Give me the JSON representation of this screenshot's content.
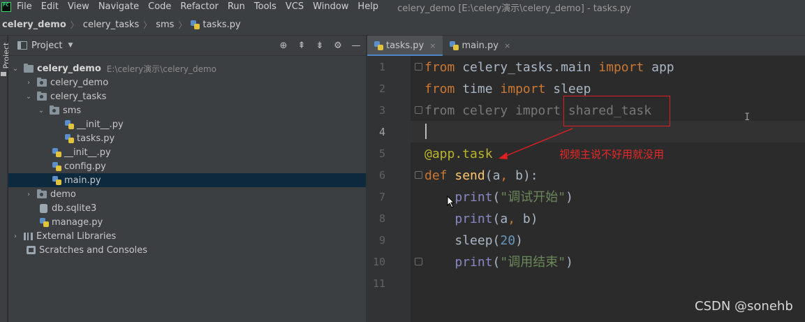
{
  "menubar": {
    "items": [
      "File",
      "Edit",
      "View",
      "Navigate",
      "Code",
      "Refactor",
      "Run",
      "Tools",
      "VCS",
      "Window",
      "Help"
    ],
    "window_title": "celery_demo [E:\\celery演示\\celery_demo] - tasks.py"
  },
  "breadcrumb": [
    "celery_demo",
    "celery_tasks",
    "sms",
    "tasks.py"
  ],
  "left_strip": {
    "label": "Project"
  },
  "project_panel": {
    "title": "Project",
    "tree": [
      {
        "label": "celery_demo",
        "path": "E:\\celery演示\\celery_demo",
        "type": "folder",
        "expanded": true,
        "bold": true
      },
      {
        "label": "celery_demo",
        "type": "package",
        "expanded": false
      },
      {
        "label": "celery_tasks",
        "type": "package",
        "expanded": true
      },
      {
        "label": "sms",
        "type": "package",
        "expanded": true
      },
      {
        "label": "__init__.py",
        "type": "python"
      },
      {
        "label": "tasks.py",
        "type": "python"
      },
      {
        "label": "__init__.py",
        "type": "python"
      },
      {
        "label": "config.py",
        "type": "python"
      },
      {
        "label": "main.py",
        "type": "python",
        "selected": true
      },
      {
        "label": "demo",
        "type": "package",
        "expanded": false
      },
      {
        "label": "db.sqlite3",
        "type": "database"
      },
      {
        "label": "manage.py",
        "type": "python"
      },
      {
        "label": "External Libraries",
        "type": "libraries",
        "expanded": false
      },
      {
        "label": "Scratches and Consoles",
        "type": "scratches"
      }
    ]
  },
  "editor_tabs": [
    {
      "label": "tasks.py",
      "active": true,
      "close": "×"
    },
    {
      "label": "main.py",
      "active": false,
      "close": "×"
    }
  ],
  "editor": {
    "current_line": 4,
    "line_numbers": [
      "1",
      "2",
      "3",
      "4",
      "5",
      "6",
      "7",
      "8",
      "9",
      "10",
      "11"
    ],
    "lines": [
      [
        [
          "kw",
          "from"
        ],
        [
          "id",
          " celery_tasks.main "
        ],
        [
          "kw",
          "import"
        ],
        [
          "id",
          " app"
        ]
      ],
      [
        [
          "kw",
          "from"
        ],
        [
          "id",
          " time "
        ],
        [
          "kw",
          "import"
        ],
        [
          "id",
          " sleep"
        ]
      ],
      [
        [
          "dim",
          "from celery import shared_task"
        ]
      ],
      [],
      [
        [
          "deco",
          "@app.task"
        ]
      ],
      [
        [
          "kw",
          "def"
        ],
        [
          "id",
          " "
        ],
        [
          "fn",
          "send"
        ],
        [
          "id",
          "("
        ],
        [
          "param",
          "a"
        ],
        [
          "kw",
          ","
        ],
        [
          "param",
          " b"
        ],
        [
          "id",
          "):"
        ]
      ],
      [
        [
          "id",
          "    "
        ],
        [
          "builtin",
          "print"
        ],
        [
          "id",
          "("
        ],
        [
          "str",
          "\"调试开始\""
        ],
        [
          "id",
          ")"
        ]
      ],
      [
        [
          "id",
          "    "
        ],
        [
          "builtin",
          "print"
        ],
        [
          "id",
          "(a"
        ],
        [
          "kw",
          ","
        ],
        [
          "id",
          " b)"
        ]
      ],
      [
        [
          "id",
          "    "
        ],
        [
          "id",
          "sleep("
        ],
        [
          "num",
          "20"
        ],
        [
          "id",
          ")"
        ]
      ],
      [
        [
          "id",
          "    "
        ],
        [
          "builtin",
          "print"
        ],
        [
          "id",
          "("
        ],
        [
          "str",
          "\"调用结束\""
        ],
        [
          "id",
          ")"
        ]
      ],
      []
    ]
  },
  "annotation": {
    "text": "视频主说不好用就没用",
    "color": "#e82828"
  },
  "watermark": "CSDN @sonehb",
  "colors": {
    "accent": "#4a88c7",
    "selection": "#0d293e",
    "keyword": "#cc7832",
    "annotation": "#e02020"
  }
}
